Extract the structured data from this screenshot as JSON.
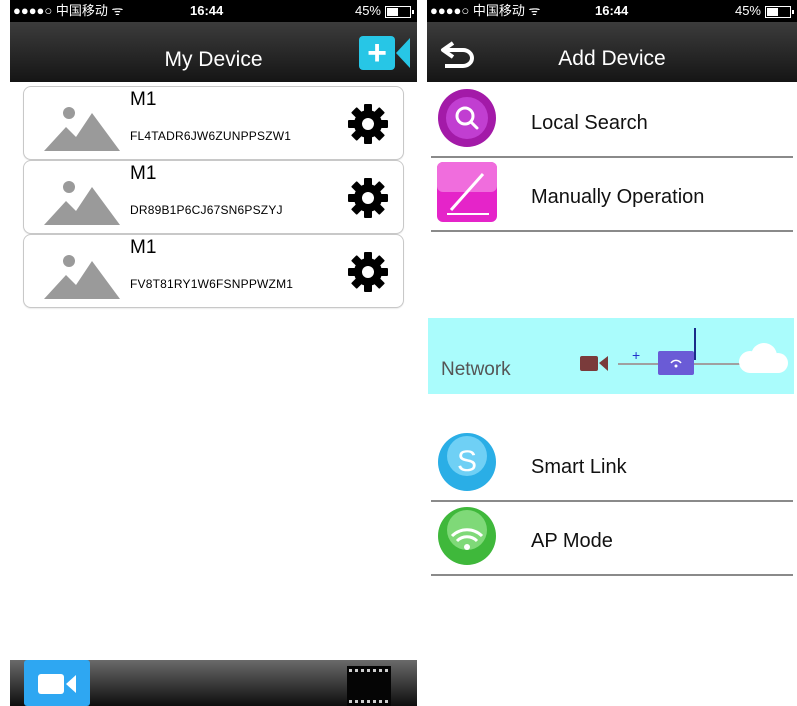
{
  "left": {
    "status": {
      "carrier": "●●●●○ 中国移动 ᯤ",
      "time": "16:44",
      "battery": "45%"
    },
    "nav": {
      "title": "My Device",
      "add_icon": "add-device-icon",
      "add_symbol": "+"
    },
    "devices": [
      {
        "name": "M1",
        "uid": "FL4TADR6JW6ZUNPPSZW1"
      },
      {
        "name": "M1",
        "uid": "DR89B1P6CJ67SN6PSZYJ"
      },
      {
        "name": "M1",
        "uid": "FV8T81RY1W6FSNPPWZM1"
      }
    ],
    "tabbar": {
      "tabs": [
        "camera-icon",
        "film-icon"
      ]
    }
  },
  "right": {
    "status": {
      "carrier": "●●●●○ 中国移动 ᯤ",
      "time": "16:44",
      "battery": "45%"
    },
    "nav": {
      "title": "Add Device",
      "back_icon": "back-arrow-icon"
    },
    "options": [
      {
        "label": "Local Search",
        "icon": "search-icon",
        "color": "#a31aa8"
      },
      {
        "label": "Manually Operation",
        "icon": "pencil-icon",
        "color": "#e524c9"
      }
    ],
    "banner": {
      "label": "Network",
      "color": "#aafcfc",
      "plus": "+"
    },
    "modes": [
      {
        "label": "Smart Link",
        "icon": "smartlink-icon",
        "color": "#2aaee6"
      },
      {
        "label": "AP Mode",
        "icon": "wifi-icon",
        "color": "#3fb83b"
      }
    ]
  }
}
